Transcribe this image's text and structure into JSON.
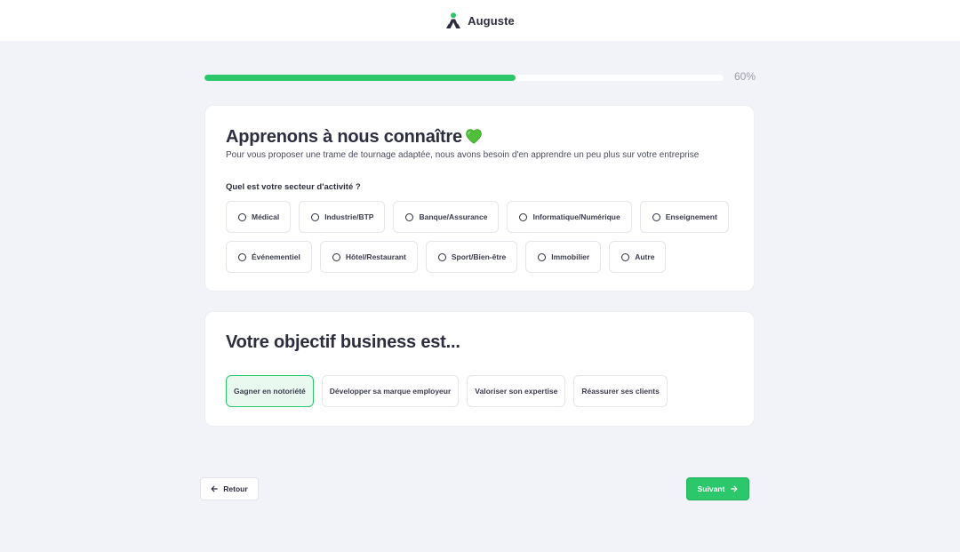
{
  "header": {
    "brand_name": "Auguste",
    "logo_icon": "auguste-logo-icon",
    "brand_color": "#2c2e3f",
    "accent_color": "#2cc76a"
  },
  "progress": {
    "value_percent": 60,
    "label": "60%"
  },
  "sector_section": {
    "title": "Apprenons à nous connaître",
    "title_icon": "green-heart-icon",
    "subtitle": "Pour vous proposer une trame de tournage adaptée, nous avons besoin d'en apprendre un peu plus sur votre entreprise",
    "question": "Quel est votre secteur d'activité ?",
    "options": [
      "Médical",
      "Industrie/BTP",
      "Banque/Assurance",
      "Informatique/Numérique",
      "Enseignement",
      "Événementiel",
      "Hôtel/Restaurant",
      "Sport/Bien-être",
      "Immobilier",
      "Autre"
    ]
  },
  "goal_section": {
    "title": "Votre objectif business est...",
    "options": [
      "Gagner en notoriété",
      "Développer sa marque employeur",
      "Valoriser son expertise",
      "Réassurer ses clients"
    ],
    "selected": "Gagner en notoriété"
  },
  "footer": {
    "back_label": "Retour",
    "next_label": "Suivant"
  }
}
